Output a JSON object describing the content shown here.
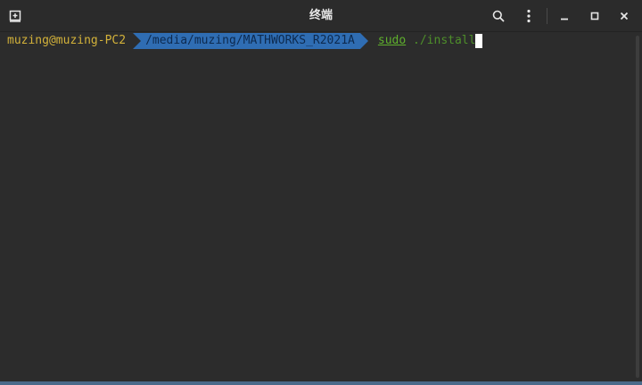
{
  "window": {
    "title": "终端"
  },
  "icons": {
    "new_tab": "new-tab-icon",
    "search": "search-icon",
    "menu": "kebab-menu-icon",
    "minimize": "minimize-icon",
    "maximize": "maximize-icon",
    "close": "close-icon"
  },
  "terminal": {
    "user_host": "muzing@muzing-PC2",
    "path": "/media/muzing/MATHWORKS_R2021A",
    "command_sudo": "sudo",
    "command_args": "./install"
  },
  "colors": {
    "background": "#2c2c2c",
    "user_host": "#d3b23a",
    "path_bg": "#2f6db3",
    "path_text": "#0d2a4f",
    "command": "#5aa02c"
  }
}
